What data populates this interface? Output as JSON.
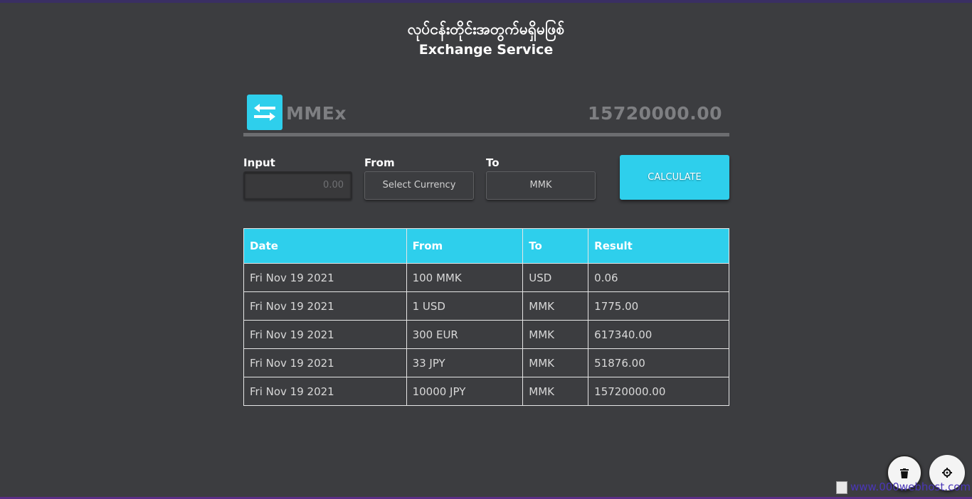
{
  "header": {
    "myanmar_title": "လုပ်ငန်းတိုင်းအတွက်မရှိမဖြစ်",
    "title": "Exchange Service"
  },
  "display": {
    "logo_icon": "swap-arrows-icon",
    "brand": "MMEx",
    "result": "15720000.00"
  },
  "form": {
    "input_label": "Input",
    "input_placeholder": "0.00",
    "from_label": "From",
    "from_value": "Select Currency",
    "to_label": "To",
    "to_value": "MMK",
    "calculate_label": "CALCULATE"
  },
  "history": {
    "headers": [
      "Date",
      "From",
      "To",
      "Result"
    ],
    "rows": [
      [
        "Fri Nov 19 2021",
        "100 MMK",
        "USD",
        "0.06"
      ],
      [
        "Fri Nov 19 2021",
        "1 USD",
        "MMK",
        "1775.00"
      ],
      [
        "Fri Nov 19 2021",
        "300 EUR",
        "MMK",
        "617340.00"
      ],
      [
        "Fri Nov 19 2021",
        "33 JPY",
        "MMK",
        "51876.00"
      ],
      [
        "Fri Nov 19 2021",
        "10000 JPY",
        "MMK",
        "15720000.00"
      ]
    ]
  },
  "fabs": {
    "trash_icon": "trash-icon",
    "settings_icon": "gear-icon"
  },
  "watermark": {
    "text": "www.000webhost.com"
  },
  "colors": {
    "background": "#3c3d40",
    "accent": "#2ecfec"
  }
}
